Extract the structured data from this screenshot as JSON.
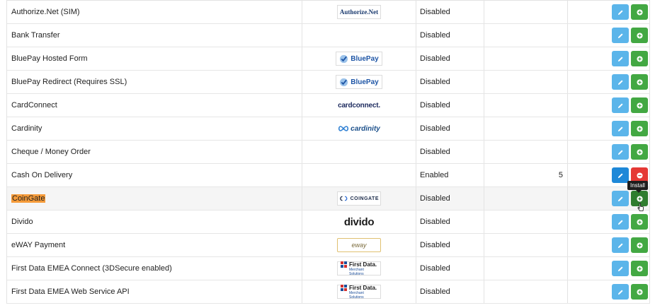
{
  "payments": [
    {
      "name": "Authorize.Net (SIM)",
      "logo": "Authorize.Net",
      "status": "Disabled",
      "sort_order": "",
      "installed": false
    },
    {
      "name": "Bank Transfer",
      "logo": "",
      "status": "Disabled",
      "sort_order": "",
      "installed": false
    },
    {
      "name": "BluePay Hosted Form",
      "logo": "BluePay",
      "status": "Disabled",
      "sort_order": "",
      "installed": false
    },
    {
      "name": "BluePay Redirect (Requires SSL)",
      "logo": "BluePay",
      "status": "Disabled",
      "sort_order": "",
      "installed": false
    },
    {
      "name": "CardConnect",
      "logo": "cardconnect.",
      "status": "Disabled",
      "sort_order": "",
      "installed": false
    },
    {
      "name": "Cardinity",
      "logo": "cardinity",
      "status": "Disabled",
      "sort_order": "",
      "installed": false
    },
    {
      "name": "Cheque / Money Order",
      "logo": "",
      "status": "Disabled",
      "sort_order": "",
      "installed": false
    },
    {
      "name": "Cash On Delivery",
      "logo": "",
      "status": "Enabled",
      "sort_order": "5",
      "installed": true
    },
    {
      "name": "CoinGate",
      "logo": "COINGATE",
      "status": "Disabled",
      "sort_order": "",
      "installed": false
    },
    {
      "name": "Divido",
      "logo": "divido",
      "status": "Disabled",
      "sort_order": "",
      "installed": false
    },
    {
      "name": "eWAY Payment",
      "logo": "eway",
      "status": "Disabled",
      "sort_order": "",
      "installed": false
    },
    {
      "name": "First Data EMEA Connect (3DSecure enabled)",
      "logo": "First Data.",
      "logo_sub": "Merchant Solutions",
      "status": "Disabled",
      "sort_order": "",
      "installed": false
    },
    {
      "name": "First Data EMEA Web Service API",
      "logo": "First Data.",
      "logo_sub": "Merchant Solutions",
      "status": "Disabled",
      "sort_order": "",
      "installed": false
    }
  ],
  "tooltip": {
    "install": "Install"
  },
  "colors": {
    "edit": "#5bb5ea",
    "install": "#43a843",
    "uninstall": "#e53935",
    "highlight": "#f59b3a"
  },
  "icons": {
    "edit": "pencil-icon",
    "install": "plus-circle-icon",
    "uninstall": "minus-circle-icon"
  }
}
